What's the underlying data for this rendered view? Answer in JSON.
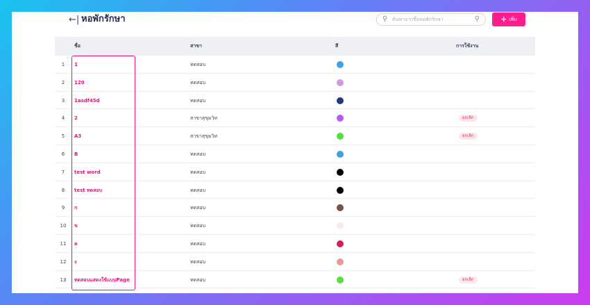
{
  "header": {
    "back_icon": "←|",
    "title": "หอพักรักษา",
    "search_placeholder": "ค้นหาจากชื่อหอพักรักษา",
    "add_label": "เพิ่ม"
  },
  "table": {
    "columns": [
      "ชื่อ",
      "สาขา",
      "สี",
      "การใช้งาน"
    ],
    "rows": [
      {
        "idx": "1",
        "name": "1",
        "branch": "ทดสอบ",
        "color": "#3fa1e6",
        "status": ""
      },
      {
        "idx": "2",
        "name": "120",
        "branch": "ทดสอบ",
        "color": "#cf9be0",
        "status": ""
      },
      {
        "idx": "3",
        "name": "1asdf45d",
        "branch": "ทดสอบ",
        "color": "#23387f",
        "status": ""
      },
      {
        "idx": "4",
        "name": "2",
        "branch": "สาขาสุขุมวิท",
        "color": "#b55cf0",
        "status": "ยกเลิก"
      },
      {
        "idx": "5",
        "name": "A3",
        "branch": "สาขาสุขุมวิท",
        "color": "#52e03a",
        "status": "ยกเลิก"
      },
      {
        "idx": "6",
        "name": "B",
        "branch": "ทดสอบ",
        "color": "#3fa1e6",
        "status": ""
      },
      {
        "idx": "7",
        "name": "test word",
        "branch": "ทดสอบ",
        "color": "#000000",
        "status": ""
      },
      {
        "idx": "8",
        "name": "test ทดสอบ",
        "branch": "ทดสอบ",
        "color": "#000000",
        "status": ""
      },
      {
        "idx": "9",
        "name": "ก",
        "branch": "ทดสอบ",
        "color": "#7a5145",
        "status": ""
      },
      {
        "idx": "10",
        "name": "ข",
        "branch": "ทดสอบ",
        "color": "#fbe9ef",
        "status": ""
      },
      {
        "idx": "11",
        "name": "ค",
        "branch": "ทดสอบ",
        "color": "#d62055",
        "status": ""
      },
      {
        "idx": "12",
        "name": "ง",
        "branch": "ทดสอบ",
        "color": "#e89a95",
        "status": ""
      },
      {
        "idx": "13",
        "name": "ทดสอบแสดงใช้แบบPage",
        "branch": "ทดสอบ",
        "color": "#52e03a",
        "status": "ยกเลิก"
      }
    ]
  }
}
